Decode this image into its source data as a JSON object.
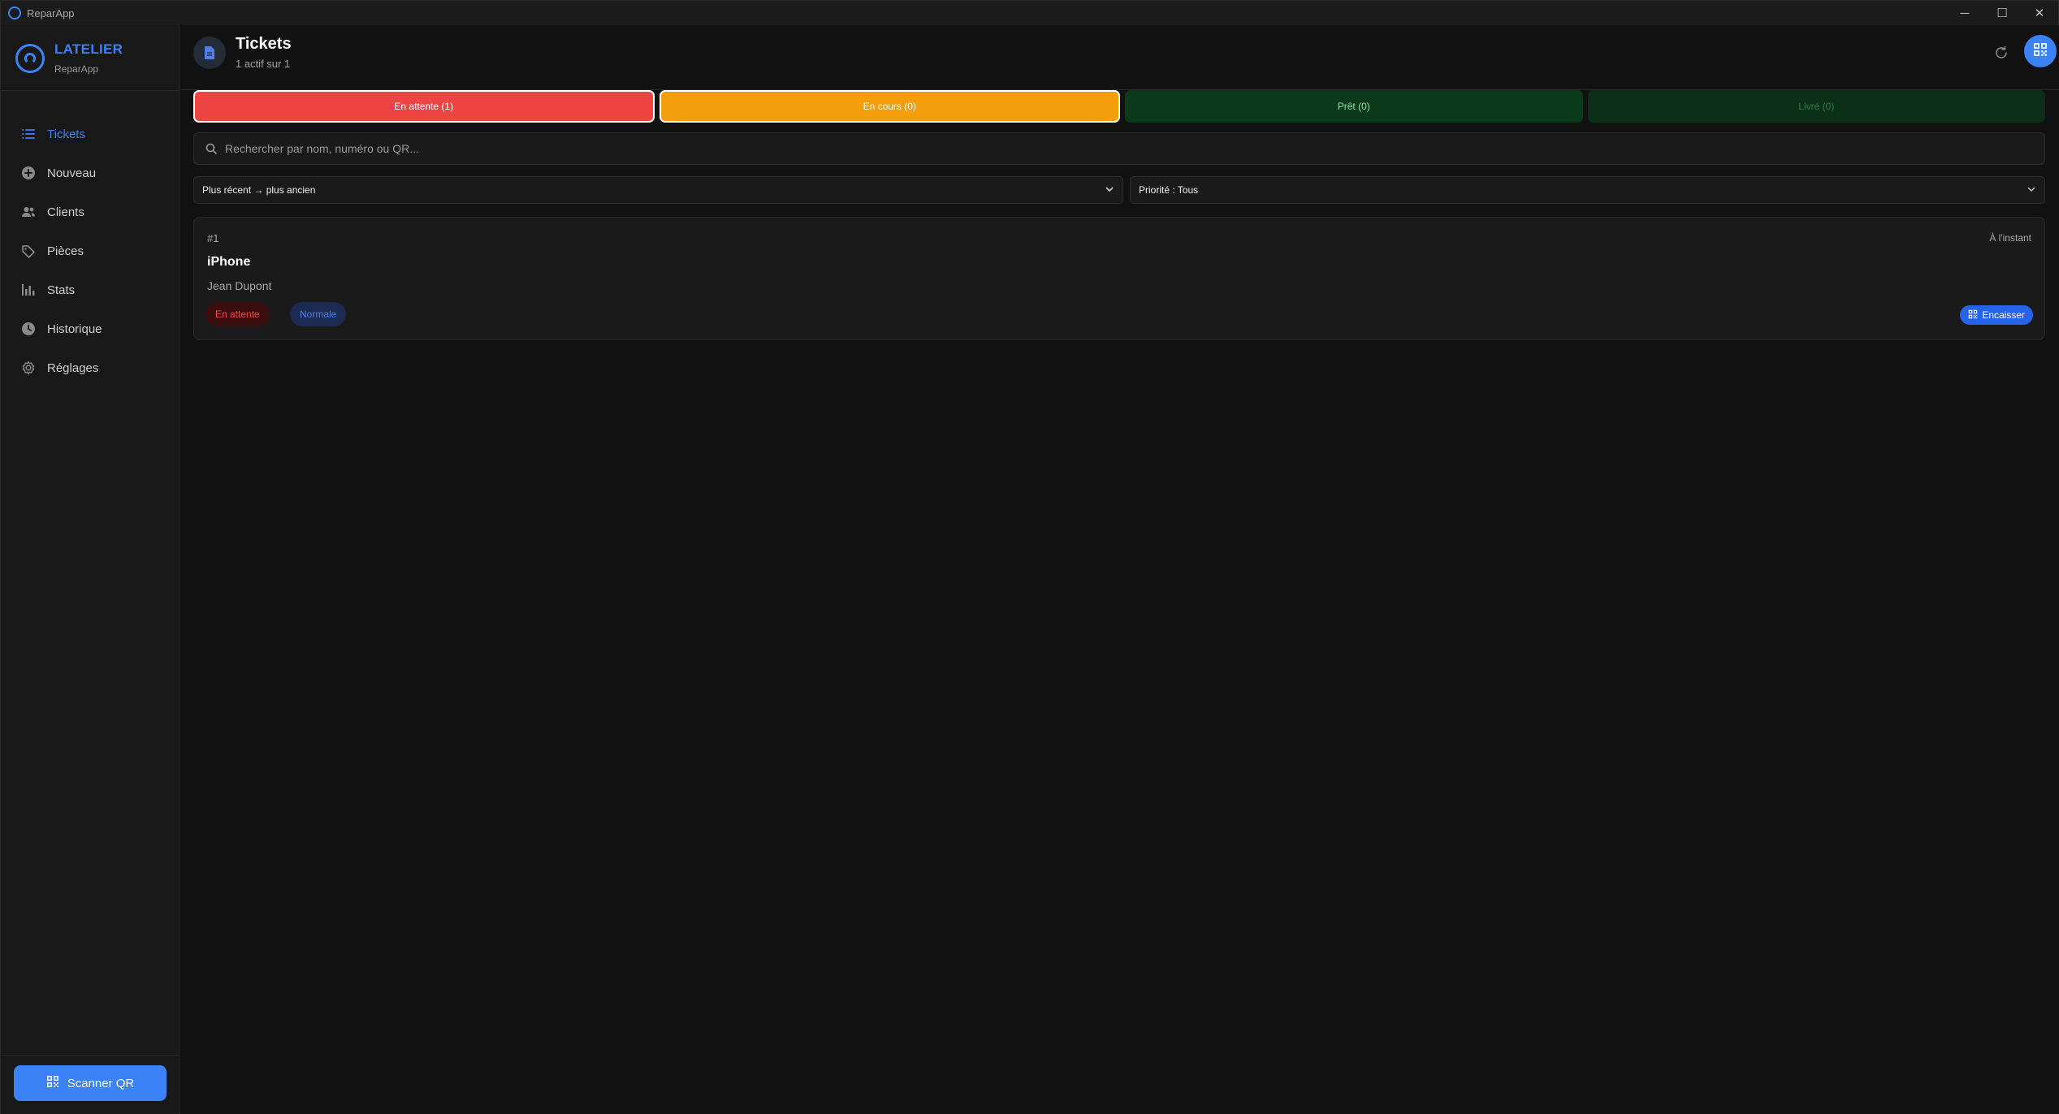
{
  "window": {
    "title": "ReparApp",
    "controls": {
      "minimize": "─",
      "maximize": "☐",
      "close": "✕"
    }
  },
  "sidebar": {
    "brand_title": "LATELIER",
    "brand_subtitle": "ReparApp",
    "items": [
      {
        "label": "Tickets",
        "icon": "list-icon",
        "active": true
      },
      {
        "label": "Nouveau",
        "icon": "plus-circle-icon",
        "active": false
      },
      {
        "label": "Clients",
        "icon": "users-icon",
        "active": false
      },
      {
        "label": "Pièces",
        "icon": "tag-icon",
        "active": false
      },
      {
        "label": "Stats",
        "icon": "bar-chart-icon",
        "active": false
      },
      {
        "label": "Historique",
        "icon": "clock-icon",
        "active": false
      },
      {
        "label": "Réglages",
        "icon": "gear-icon",
        "active": false
      }
    ],
    "scan_label": "Scanner QR"
  },
  "header": {
    "title": "Tickets",
    "subtitle": "1 actif sur 1"
  },
  "tabs": [
    {
      "label": "En attente (1)"
    },
    {
      "label": "En cours (0)"
    },
    {
      "label": "Prêt (0)"
    },
    {
      "label": "Livré (0)"
    }
  ],
  "search": {
    "placeholder": "Rechercher par nom, numéro ou QR..."
  },
  "filters": {
    "sort_value": "Plus récent → plus ancien",
    "priority_value": "Priorité : Tous"
  },
  "tickets": [
    {
      "number": "#1",
      "time": "À l'instant",
      "device": "iPhone",
      "client": "Jean Dupont",
      "status": "En attente",
      "priority": "Normale",
      "action_label": "Encaisser"
    }
  ],
  "colors": {
    "accent": "#3b82f6",
    "pending": "#ef4444",
    "in_progress": "#f59e0b",
    "ready": "#0a3a1a",
    "delivered": "#0a2f16"
  }
}
